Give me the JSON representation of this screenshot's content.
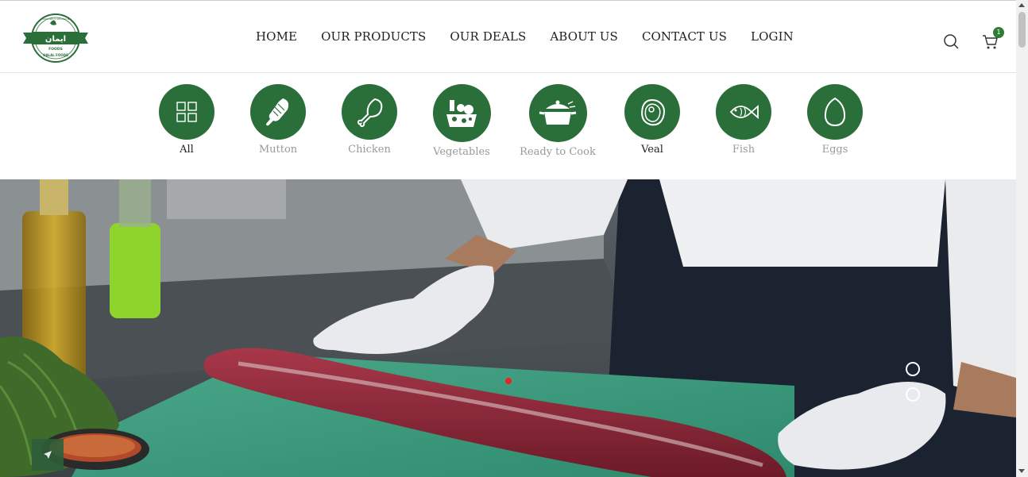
{
  "brand": {
    "logo_text_top": "PURE LIKE IT SHOULD BE",
    "logo_text_urdu": "ایمان",
    "logo_text_foods": "FOODS",
    "logo_text_bottom": "HALAL FOODS",
    "color": "#2a6e3a"
  },
  "nav": {
    "items": [
      "HOME",
      "OUR PRODUCTS",
      "OUR DEALS",
      "ABOUT US",
      "CONTACT US",
      "LOGIN"
    ]
  },
  "header_actions": {
    "search_icon": "search-icon",
    "cart_icon": "cart-icon",
    "cart_count": "1"
  },
  "categories": {
    "items": [
      {
        "label": "All",
        "icon": "grid-icon",
        "active": true
      },
      {
        "label": "Mutton",
        "icon": "mutton-leg-icon",
        "active": false
      },
      {
        "label": "Chicken",
        "icon": "chicken-drumstick-icon",
        "active": false
      },
      {
        "label": "Vegetables",
        "icon": "vegetables-basket-icon",
        "active": false
      },
      {
        "label": "Ready to Cook",
        "icon": "cooking-pot-icon",
        "active": false
      },
      {
        "label": "Veal",
        "icon": "veal-steak-icon",
        "active": true
      },
      {
        "label": "Fish",
        "icon": "fish-icon",
        "active": false
      },
      {
        "label": "Eggs",
        "icon": "egg-icon",
        "active": false
      }
    ]
  },
  "hero": {
    "image": "chef-slicing-raw-meat-on-green-board",
    "active_slide": 1,
    "slide_count": 2
  },
  "colors": {
    "accent": "#2a6e3a",
    "slide_dot": "#e22222"
  }
}
